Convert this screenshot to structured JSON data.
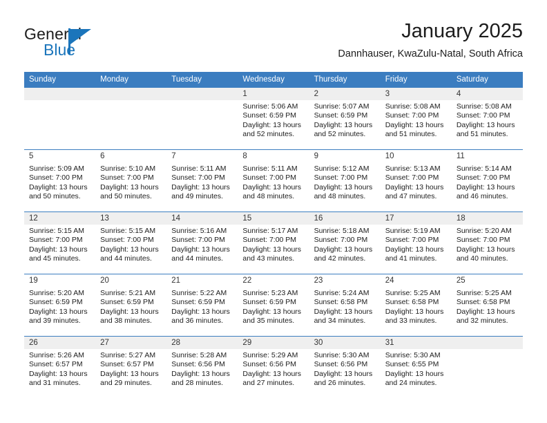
{
  "brand": {
    "name_part1": "General",
    "name_part2": "Blue",
    "logo_icon": "flag-triangle-icon"
  },
  "header": {
    "title": "January 2025",
    "location": "Dannhauser, KwaZulu-Natal, South Africa"
  },
  "calendar": {
    "accent_color": "#3b7dc0",
    "shade_color": "#efefef",
    "weekday_headers": [
      "Sunday",
      "Monday",
      "Tuesday",
      "Wednesday",
      "Thursday",
      "Friday",
      "Saturday"
    ],
    "labels": {
      "sunrise": "Sunrise:",
      "sunset": "Sunset:",
      "daylight": "Daylight:"
    },
    "weeks": [
      [
        {
          "day": "",
          "sunrise": "",
          "sunset": "",
          "daylight_line1": "",
          "daylight_line2": ""
        },
        {
          "day": "",
          "sunrise": "",
          "sunset": "",
          "daylight_line1": "",
          "daylight_line2": ""
        },
        {
          "day": "",
          "sunrise": "",
          "sunset": "",
          "daylight_line1": "",
          "daylight_line2": ""
        },
        {
          "day": "1",
          "sunrise": "Sunrise: 5:06 AM",
          "sunset": "Sunset: 6:59 PM",
          "daylight_line1": "Daylight: 13 hours",
          "daylight_line2": "and 52 minutes."
        },
        {
          "day": "2",
          "sunrise": "Sunrise: 5:07 AM",
          "sunset": "Sunset: 6:59 PM",
          "daylight_line1": "Daylight: 13 hours",
          "daylight_line2": "and 52 minutes."
        },
        {
          "day": "3",
          "sunrise": "Sunrise: 5:08 AM",
          "sunset": "Sunset: 7:00 PM",
          "daylight_line1": "Daylight: 13 hours",
          "daylight_line2": "and 51 minutes."
        },
        {
          "day": "4",
          "sunrise": "Sunrise: 5:08 AM",
          "sunset": "Sunset: 7:00 PM",
          "daylight_line1": "Daylight: 13 hours",
          "daylight_line2": "and 51 minutes."
        }
      ],
      [
        {
          "day": "5",
          "sunrise": "Sunrise: 5:09 AM",
          "sunset": "Sunset: 7:00 PM",
          "daylight_line1": "Daylight: 13 hours",
          "daylight_line2": "and 50 minutes."
        },
        {
          "day": "6",
          "sunrise": "Sunrise: 5:10 AM",
          "sunset": "Sunset: 7:00 PM",
          "daylight_line1": "Daylight: 13 hours",
          "daylight_line2": "and 50 minutes."
        },
        {
          "day": "7",
          "sunrise": "Sunrise: 5:11 AM",
          "sunset": "Sunset: 7:00 PM",
          "daylight_line1": "Daylight: 13 hours",
          "daylight_line2": "and 49 minutes."
        },
        {
          "day": "8",
          "sunrise": "Sunrise: 5:11 AM",
          "sunset": "Sunset: 7:00 PM",
          "daylight_line1": "Daylight: 13 hours",
          "daylight_line2": "and 48 minutes."
        },
        {
          "day": "9",
          "sunrise": "Sunrise: 5:12 AM",
          "sunset": "Sunset: 7:00 PM",
          "daylight_line1": "Daylight: 13 hours",
          "daylight_line2": "and 48 minutes."
        },
        {
          "day": "10",
          "sunrise": "Sunrise: 5:13 AM",
          "sunset": "Sunset: 7:00 PM",
          "daylight_line1": "Daylight: 13 hours",
          "daylight_line2": "and 47 minutes."
        },
        {
          "day": "11",
          "sunrise": "Sunrise: 5:14 AM",
          "sunset": "Sunset: 7:00 PM",
          "daylight_line1": "Daylight: 13 hours",
          "daylight_line2": "and 46 minutes."
        }
      ],
      [
        {
          "day": "12",
          "sunrise": "Sunrise: 5:15 AM",
          "sunset": "Sunset: 7:00 PM",
          "daylight_line1": "Daylight: 13 hours",
          "daylight_line2": "and 45 minutes."
        },
        {
          "day": "13",
          "sunrise": "Sunrise: 5:15 AM",
          "sunset": "Sunset: 7:00 PM",
          "daylight_line1": "Daylight: 13 hours",
          "daylight_line2": "and 44 minutes."
        },
        {
          "day": "14",
          "sunrise": "Sunrise: 5:16 AM",
          "sunset": "Sunset: 7:00 PM",
          "daylight_line1": "Daylight: 13 hours",
          "daylight_line2": "and 44 minutes."
        },
        {
          "day": "15",
          "sunrise": "Sunrise: 5:17 AM",
          "sunset": "Sunset: 7:00 PM",
          "daylight_line1": "Daylight: 13 hours",
          "daylight_line2": "and 43 minutes."
        },
        {
          "day": "16",
          "sunrise": "Sunrise: 5:18 AM",
          "sunset": "Sunset: 7:00 PM",
          "daylight_line1": "Daylight: 13 hours",
          "daylight_line2": "and 42 minutes."
        },
        {
          "day": "17",
          "sunrise": "Sunrise: 5:19 AM",
          "sunset": "Sunset: 7:00 PM",
          "daylight_line1": "Daylight: 13 hours",
          "daylight_line2": "and 41 minutes."
        },
        {
          "day": "18",
          "sunrise": "Sunrise: 5:20 AM",
          "sunset": "Sunset: 7:00 PM",
          "daylight_line1": "Daylight: 13 hours",
          "daylight_line2": "and 40 minutes."
        }
      ],
      [
        {
          "day": "19",
          "sunrise": "Sunrise: 5:20 AM",
          "sunset": "Sunset: 6:59 PM",
          "daylight_line1": "Daylight: 13 hours",
          "daylight_line2": "and 39 minutes."
        },
        {
          "day": "20",
          "sunrise": "Sunrise: 5:21 AM",
          "sunset": "Sunset: 6:59 PM",
          "daylight_line1": "Daylight: 13 hours",
          "daylight_line2": "and 38 minutes."
        },
        {
          "day": "21",
          "sunrise": "Sunrise: 5:22 AM",
          "sunset": "Sunset: 6:59 PM",
          "daylight_line1": "Daylight: 13 hours",
          "daylight_line2": "and 36 minutes."
        },
        {
          "day": "22",
          "sunrise": "Sunrise: 5:23 AM",
          "sunset": "Sunset: 6:59 PM",
          "daylight_line1": "Daylight: 13 hours",
          "daylight_line2": "and 35 minutes."
        },
        {
          "day": "23",
          "sunrise": "Sunrise: 5:24 AM",
          "sunset": "Sunset: 6:58 PM",
          "daylight_line1": "Daylight: 13 hours",
          "daylight_line2": "and 34 minutes."
        },
        {
          "day": "24",
          "sunrise": "Sunrise: 5:25 AM",
          "sunset": "Sunset: 6:58 PM",
          "daylight_line1": "Daylight: 13 hours",
          "daylight_line2": "and 33 minutes."
        },
        {
          "day": "25",
          "sunrise": "Sunrise: 5:25 AM",
          "sunset": "Sunset: 6:58 PM",
          "daylight_line1": "Daylight: 13 hours",
          "daylight_line2": "and 32 minutes."
        }
      ],
      [
        {
          "day": "26",
          "sunrise": "Sunrise: 5:26 AM",
          "sunset": "Sunset: 6:57 PM",
          "daylight_line1": "Daylight: 13 hours",
          "daylight_line2": "and 31 minutes."
        },
        {
          "day": "27",
          "sunrise": "Sunrise: 5:27 AM",
          "sunset": "Sunset: 6:57 PM",
          "daylight_line1": "Daylight: 13 hours",
          "daylight_line2": "and 29 minutes."
        },
        {
          "day": "28",
          "sunrise": "Sunrise: 5:28 AM",
          "sunset": "Sunset: 6:56 PM",
          "daylight_line1": "Daylight: 13 hours",
          "daylight_line2": "and 28 minutes."
        },
        {
          "day": "29",
          "sunrise": "Sunrise: 5:29 AM",
          "sunset": "Sunset: 6:56 PM",
          "daylight_line1": "Daylight: 13 hours",
          "daylight_line2": "and 27 minutes."
        },
        {
          "day": "30",
          "sunrise": "Sunrise: 5:30 AM",
          "sunset": "Sunset: 6:56 PM",
          "daylight_line1": "Daylight: 13 hours",
          "daylight_line2": "and 26 minutes."
        },
        {
          "day": "31",
          "sunrise": "Sunrise: 5:30 AM",
          "sunset": "Sunset: 6:55 PM",
          "daylight_line1": "Daylight: 13 hours",
          "daylight_line2": "and 24 minutes."
        },
        {
          "day": "",
          "sunrise": "",
          "sunset": "",
          "daylight_line1": "",
          "daylight_line2": ""
        }
      ]
    ]
  }
}
